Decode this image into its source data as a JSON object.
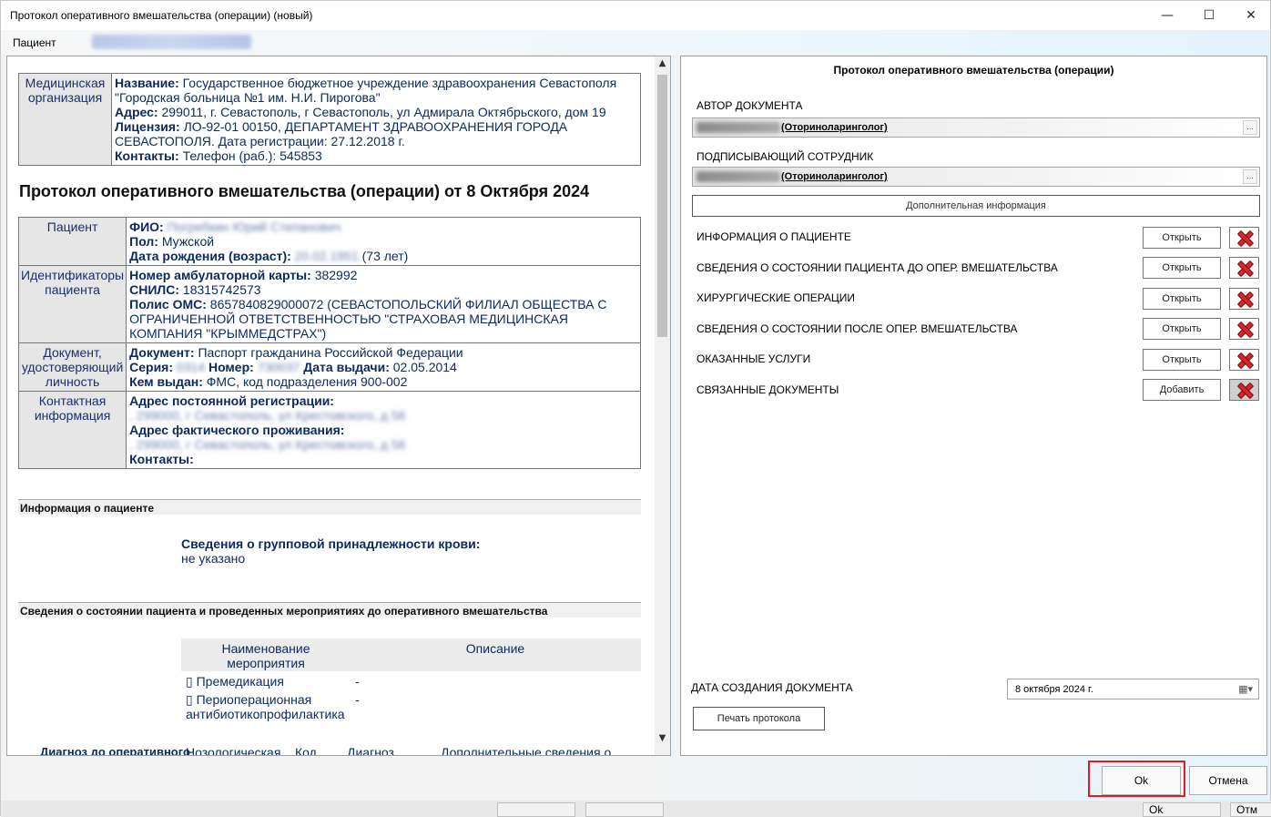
{
  "window": {
    "title": "Протокол оперативного вмешательства (операции) (новый)",
    "minimize_glyph": "—",
    "maximize_glyph": "☐",
    "close_glyph": "✕"
  },
  "menu": {
    "patient_label": "Пациент"
  },
  "org": {
    "label": "Медицинская организация",
    "name_key": "Название:",
    "name": "Государственное бюджетное учреждение здравоохранения Севастополя \"Городская больница №1 им. Н.И. Пирогова\"",
    "address_key": "Адрес:",
    "address": "299011, г. Севастополь, г Севастополь, ул Адмирала Октябрьского, дом 19",
    "license_key": "Лицензия:",
    "license": "ЛО-92-01 00150, ДЕПАРТАМЕНТ ЗДРАВООХРАНЕНИЯ ГОРОДА СЕВАСТОПОЛЯ. Дата регистрации: 27.12.2018 г.",
    "contacts_key": "Контакты:",
    "contacts": "Телефон (раб.): 545853"
  },
  "doc_heading": "Протокол оперативного вмешательства (операции) от 8 Октября 2024",
  "patient": {
    "label": "Пациент",
    "fio_key": "ФИО:",
    "sex_key": "Пол:",
    "sex": "Мужской",
    "dob_key": "Дата рождения (возраст):",
    "age": "(73 лет)",
    "ids_label": "Идентификаторы пациента",
    "card_key": "Номер амбулаторной карты:",
    "card": "382992",
    "snils_key": "СНИЛС:",
    "snils": "18315742573",
    "oms_key": "Полис ОМС:",
    "oms": "8657840829000072 (СЕВАСТОПОЛЬСКИЙ ФИЛИАЛ ОБЩЕСТВА С ОГРАНИЧЕННОЙ ОТВЕТСТВЕННОСТЬЮ \"СТРАХОВАЯ МЕДИЦИНСКАЯ КОМПАНИЯ \"КРЫММЕДСТРАХ\")",
    "doc_label": "Документ, удостоверяющий личность",
    "doc_key": "Документ:",
    "doc": "Паспорт гражданина Российской Федерации",
    "series_key": "Серия:",
    "number_key": "Номер:",
    "issue_date_key": "Дата выдачи:",
    "issue_date": "02.05.2014",
    "issued_by_key": "Кем выдан:",
    "issued_by": "ФМС, код подразделения 900-002",
    "contact_label": "Контактная информация",
    "reg_addr_key": "Адрес постоянной регистрации:",
    "fact_addr_key": "Адрес фактического проживания:",
    "contacts_key": "Контакты:"
  },
  "sections": {
    "patient_info": "Информация о пациенте",
    "blood_title": "Сведения о групповой принадлежности крови:",
    "blood_value": "не указано",
    "pre_state": "Сведения о состоянии пациента и проведенных мероприятиях до оперативного вмешательства",
    "col_measure": "Наименование мероприятия",
    "col_desc": "Описание",
    "measures": [
      {
        "name": "▯ Премедикация",
        "desc": "-"
      },
      {
        "name": "▯ Периоперационная антибиотикопрофилактика",
        "desc": "-"
      }
    ],
    "diag_label": "Диагноз до оперативного",
    "diag_col1": "Нозологическая",
    "diag_col2": "Код",
    "diag_col3": "Диагноз",
    "diag_col4": "Дополнительные сведения о"
  },
  "form": {
    "title": "Протокол оперативного вмешательства (операции)",
    "author_label": "АВТОР ДОКУМЕНТА",
    "author_role": "(Оториноларинголог)",
    "signer_label": "ПОДПИСЫВАЮЩИЙ СОТРУДНИК",
    "signer_role": "(Оториноларинголог)",
    "dots": "...",
    "extra_info": "Дополнительная информация",
    "rows": [
      {
        "label": "ИНФОРМАЦИЯ О ПАЦИЕНТЕ",
        "button": "Открыть"
      },
      {
        "label": "СВЕДЕНИЯ О СОСТОЯНИИ ПАЦИЕНТА ДО ОПЕР. ВМЕШАТЕЛЬСТВА",
        "button": "Открыть"
      },
      {
        "label": "ХИРУРГИЧЕСКИЕ ОПЕРАЦИИ",
        "button": "Открыть"
      },
      {
        "label": "СВЕДЕНИЯ О СОСТОЯНИИ ПОСЛЕ ОПЕР. ВМЕШАТЕЛЬСТВА",
        "button": "Открыть"
      },
      {
        "label": "ОКАЗАННЫЕ УСЛУГИ",
        "button": "Открыть"
      },
      {
        "label": "СВЯЗАННЫЕ ДОКУМЕНТЫ",
        "button": "Добавить"
      }
    ],
    "date_label": "ДАТА СОЗДАНИЯ ДОКУМЕНТА",
    "date_value": "8  октября  2024 г.",
    "print_button": "Печать протокола"
  },
  "footer": {
    "ok": "Ok",
    "cancel": "Отмена",
    "background_tab_1": "Ok",
    "background_tab_2": "Отм"
  },
  "colors": {
    "highlight": "#d91f26",
    "delete_icon": "#d8262b",
    "doc_text": "#0d2b60"
  }
}
